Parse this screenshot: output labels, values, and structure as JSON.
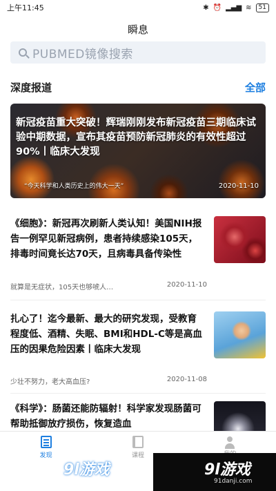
{
  "status_bar": {
    "time": "上午11:45",
    "battery": "51"
  },
  "app": {
    "title": "瞬息"
  },
  "search": {
    "placeholder": "PUBMED镜像搜索"
  },
  "section": {
    "title": "深度报道",
    "all_label": "全部"
  },
  "hero": {
    "headline": "新冠疫苗重大突破！辉瑞刚刚发布新冠疫苗三期临床试验中期数据，宣布其疫苗预防新冠肺炎的有效性超过90%丨临床大发现",
    "quote": "“今天科学和人类历史上的伟大一天”",
    "date": "2020-11-10"
  },
  "articles": [
    {
      "title": "《细胞》：新冠再次刷新人类认知！美国NIH报告一例罕见新冠病例，患者持续感染105天，排毒时间竟长达70天，且病毒具备传染性",
      "subtitle": "就算是无症状，105天也够唬人…",
      "date": "2020-11-10",
      "thumb_icon": "virus-image"
    },
    {
      "title": "扎心了！迄今最新、最大的研究发现，受教育程度低、酒精、失眠、BMI和HDL-C等是高血压的因果危险因素丨临床大发现",
      "subtitle": "少壮不努力，老大高血压?",
      "date": "2020-11-08",
      "thumb_icon": "child-image"
    },
    {
      "title": "《科学》：肠菌还能防辐射！科学家发现肠菌可帮助抵御放疗损伤，恢复造血",
      "subtitle": "",
      "date": "",
      "thumb_icon": "xray-image"
    }
  ],
  "tabbar": {
    "tabs": [
      {
        "label": "发现"
      },
      {
        "label": "课程"
      },
      {
        "label": "我的"
      }
    ]
  },
  "watermark": {
    "left": "9l游戏",
    "right_logo": "9l游戏",
    "right_url": "91danji.com"
  },
  "colors": {
    "accent": "#1e7fe0"
  }
}
